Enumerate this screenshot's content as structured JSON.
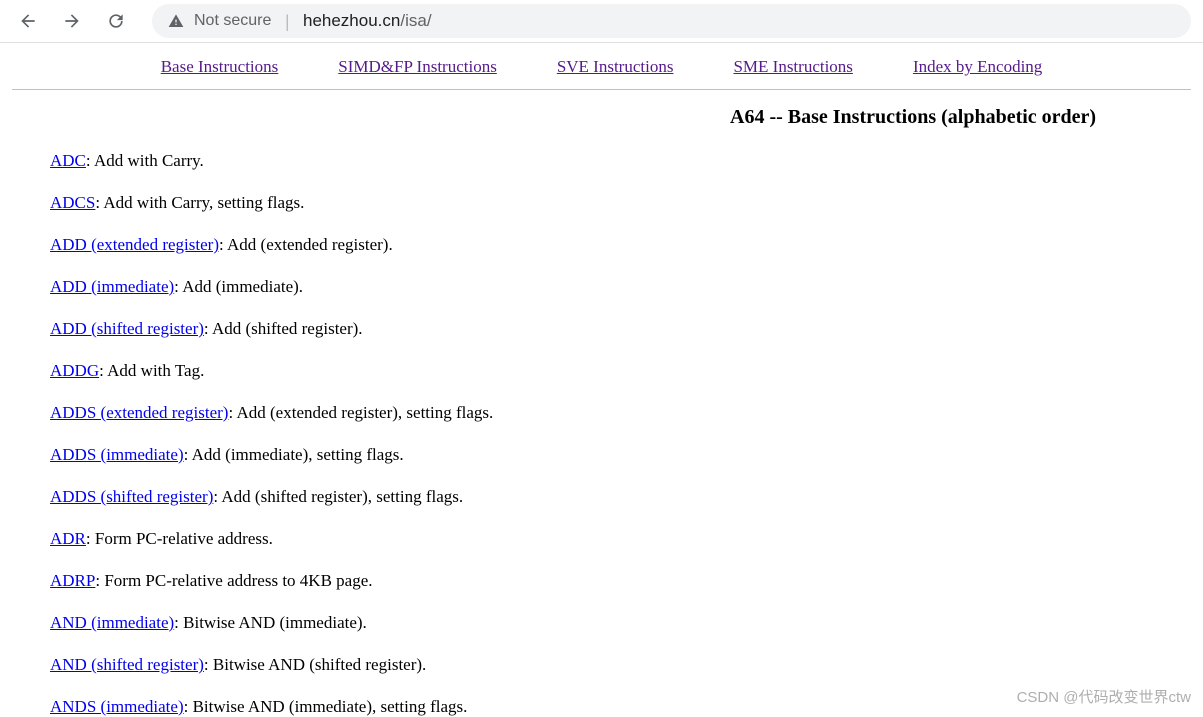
{
  "browser": {
    "not_secure": "Not secure",
    "url_host": "hehezhou.cn",
    "url_path": "/isa/"
  },
  "tabs": [
    {
      "label": "Base Instructions"
    },
    {
      "label": "SIMD&FP Instructions"
    },
    {
      "label": "SVE Instructions"
    },
    {
      "label": "SME Instructions"
    },
    {
      "label": "Index by Encoding"
    }
  ],
  "title": "A64 -- Base Instructions (alphabetic order)",
  "instructions": [
    {
      "name": "ADC",
      "desc": ": Add with Carry."
    },
    {
      "name": "ADCS",
      "desc": ": Add with Carry, setting flags."
    },
    {
      "name": "ADD (extended register)",
      "desc": ": Add (extended register)."
    },
    {
      "name": "ADD (immediate)",
      "desc": ": Add (immediate)."
    },
    {
      "name": "ADD (shifted register)",
      "desc": ": Add (shifted register)."
    },
    {
      "name": "ADDG",
      "desc": ": Add with Tag."
    },
    {
      "name": "ADDS (extended register)",
      "desc": ": Add (extended register), setting flags."
    },
    {
      "name": "ADDS (immediate)",
      "desc": ": Add (immediate), setting flags."
    },
    {
      "name": "ADDS (shifted register)",
      "desc": ": Add (shifted register), setting flags."
    },
    {
      "name": "ADR",
      "desc": ": Form PC-relative address."
    },
    {
      "name": "ADRP",
      "desc": ": Form PC-relative address to 4KB page."
    },
    {
      "name": "AND (immediate)",
      "desc": ": Bitwise AND (immediate)."
    },
    {
      "name": "AND (shifted register)",
      "desc": ": Bitwise AND (shifted register)."
    },
    {
      "name": "ANDS (immediate)",
      "desc": ": Bitwise AND (immediate), setting flags."
    }
  ],
  "watermark": "CSDN @代码改变世界ctw"
}
